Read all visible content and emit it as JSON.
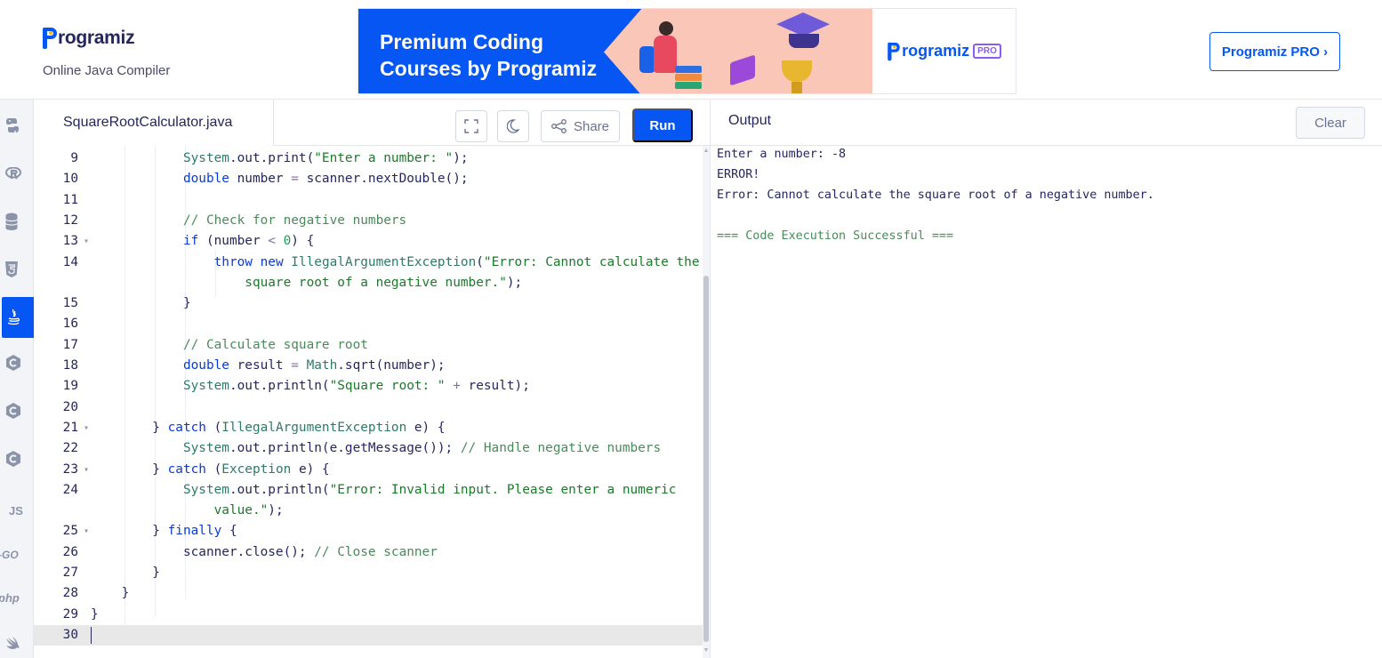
{
  "header": {
    "logo_text": "rogramiz",
    "subtitle": "Online Java Compiler",
    "banner": {
      "title_line1": "Premium Coding",
      "title_line2": "Courses by Programiz",
      "pro_logo_text": "rogramiz",
      "pro_badge": "PRO"
    },
    "pro_button_label": "Programiz PRO ›"
  },
  "sidebar": {
    "items": [
      {
        "name": "python-icon",
        "label": ""
      },
      {
        "name": "r-icon",
        "label": ""
      },
      {
        "name": "sql-icon",
        "label": ""
      },
      {
        "name": "html-icon",
        "label": ""
      },
      {
        "name": "java-icon",
        "label": "",
        "active": true
      },
      {
        "name": "c-icon",
        "label": ""
      },
      {
        "name": "cpp-icon",
        "label": ""
      },
      {
        "name": "csharp-icon",
        "label": ""
      },
      {
        "name": "js-icon",
        "label": "JS"
      },
      {
        "name": "go-icon",
        "label": "-GO"
      },
      {
        "name": "php-icon",
        "label": "php"
      },
      {
        "name": "swift-icon",
        "label": ""
      }
    ]
  },
  "editor": {
    "file_name": "SquareRootCalculator.java",
    "share_label": "Share",
    "run_label": "Run",
    "lines": [
      {
        "n": "9",
        "fold": false
      },
      {
        "n": "10",
        "fold": false
      },
      {
        "n": "11",
        "fold": false
      },
      {
        "n": "12",
        "fold": false
      },
      {
        "n": "13",
        "fold": true
      },
      {
        "n": "14",
        "fold": false
      },
      {
        "n": "",
        "fold": false
      },
      {
        "n": "15",
        "fold": false
      },
      {
        "n": "16",
        "fold": false
      },
      {
        "n": "17",
        "fold": false
      },
      {
        "n": "18",
        "fold": false
      },
      {
        "n": "19",
        "fold": false
      },
      {
        "n": "20",
        "fold": false
      },
      {
        "n": "21",
        "fold": true
      },
      {
        "n": "22",
        "fold": false
      },
      {
        "n": "23",
        "fold": true
      },
      {
        "n": "24",
        "fold": false
      },
      {
        "n": "",
        "fold": false
      },
      {
        "n": "25",
        "fold": true
      },
      {
        "n": "26",
        "fold": false
      },
      {
        "n": "27",
        "fold": false
      },
      {
        "n": "28",
        "fold": false
      },
      {
        "n": "29",
        "fold": false
      },
      {
        "n": "30",
        "fold": false
      }
    ],
    "code": {
      "l9": [
        "            ",
        "System",
        ".out.print(",
        "\"Enter a number: \"",
        ");"
      ],
      "l10": [
        "            ",
        "double",
        " number ",
        "=",
        " scanner.nextDouble();"
      ],
      "l12": [
        "            ",
        "// Check for negative numbers"
      ],
      "l13": [
        "            ",
        "if",
        " (number ",
        "<",
        " ",
        "0",
        ") {"
      ],
      "l14": [
        "                ",
        "throw",
        " ",
        "new",
        " ",
        "IllegalArgumentException",
        "(",
        "\"Error: Cannot calculate the"
      ],
      "l14b": [
        "                    ",
        "square root of a negative number.\"",
        ");"
      ],
      "l15": [
        "            }"
      ],
      "l17": [
        "            ",
        "// Calculate square root"
      ],
      "l18": [
        "            ",
        "double",
        " result ",
        "=",
        " ",
        "Math",
        ".sqrt(number);"
      ],
      "l19": [
        "            ",
        "System",
        ".out.println(",
        "\"Square root: \"",
        " ",
        "+",
        " result);"
      ],
      "l21": [
        "        } ",
        "catch",
        " (",
        "IllegalArgumentException",
        " e) {"
      ],
      "l22": [
        "            ",
        "System",
        ".out.println(e.getMessage()); ",
        "// Handle negative numbers"
      ],
      "l23": [
        "        } ",
        "catch",
        " (",
        "Exception",
        " e) {"
      ],
      "l24": [
        "            ",
        "System",
        ".out.println(",
        "\"Error: Invalid input. Please enter a numeric"
      ],
      "l24b": [
        "                ",
        "value.\"",
        ");"
      ],
      "l25": [
        "        } ",
        "finally",
        " {"
      ],
      "l26": [
        "            scanner.close(); ",
        "// Close scanner"
      ],
      "l27": [
        "        }"
      ],
      "l28": [
        "    }"
      ],
      "l29": [
        "}"
      ]
    }
  },
  "output": {
    "title": "Output",
    "clear_label": "Clear",
    "lines": [
      "Enter a number: -8",
      "ERROR!",
      "Error: Cannot calculate the square root of a negative number.",
      "",
      "=== Code Execution Successful ==="
    ]
  },
  "colors": {
    "brand_blue": "#0556f3",
    "keyword": "#0b39d6",
    "string": "#1a7a2a",
    "comment": "#4a8a5a"
  }
}
